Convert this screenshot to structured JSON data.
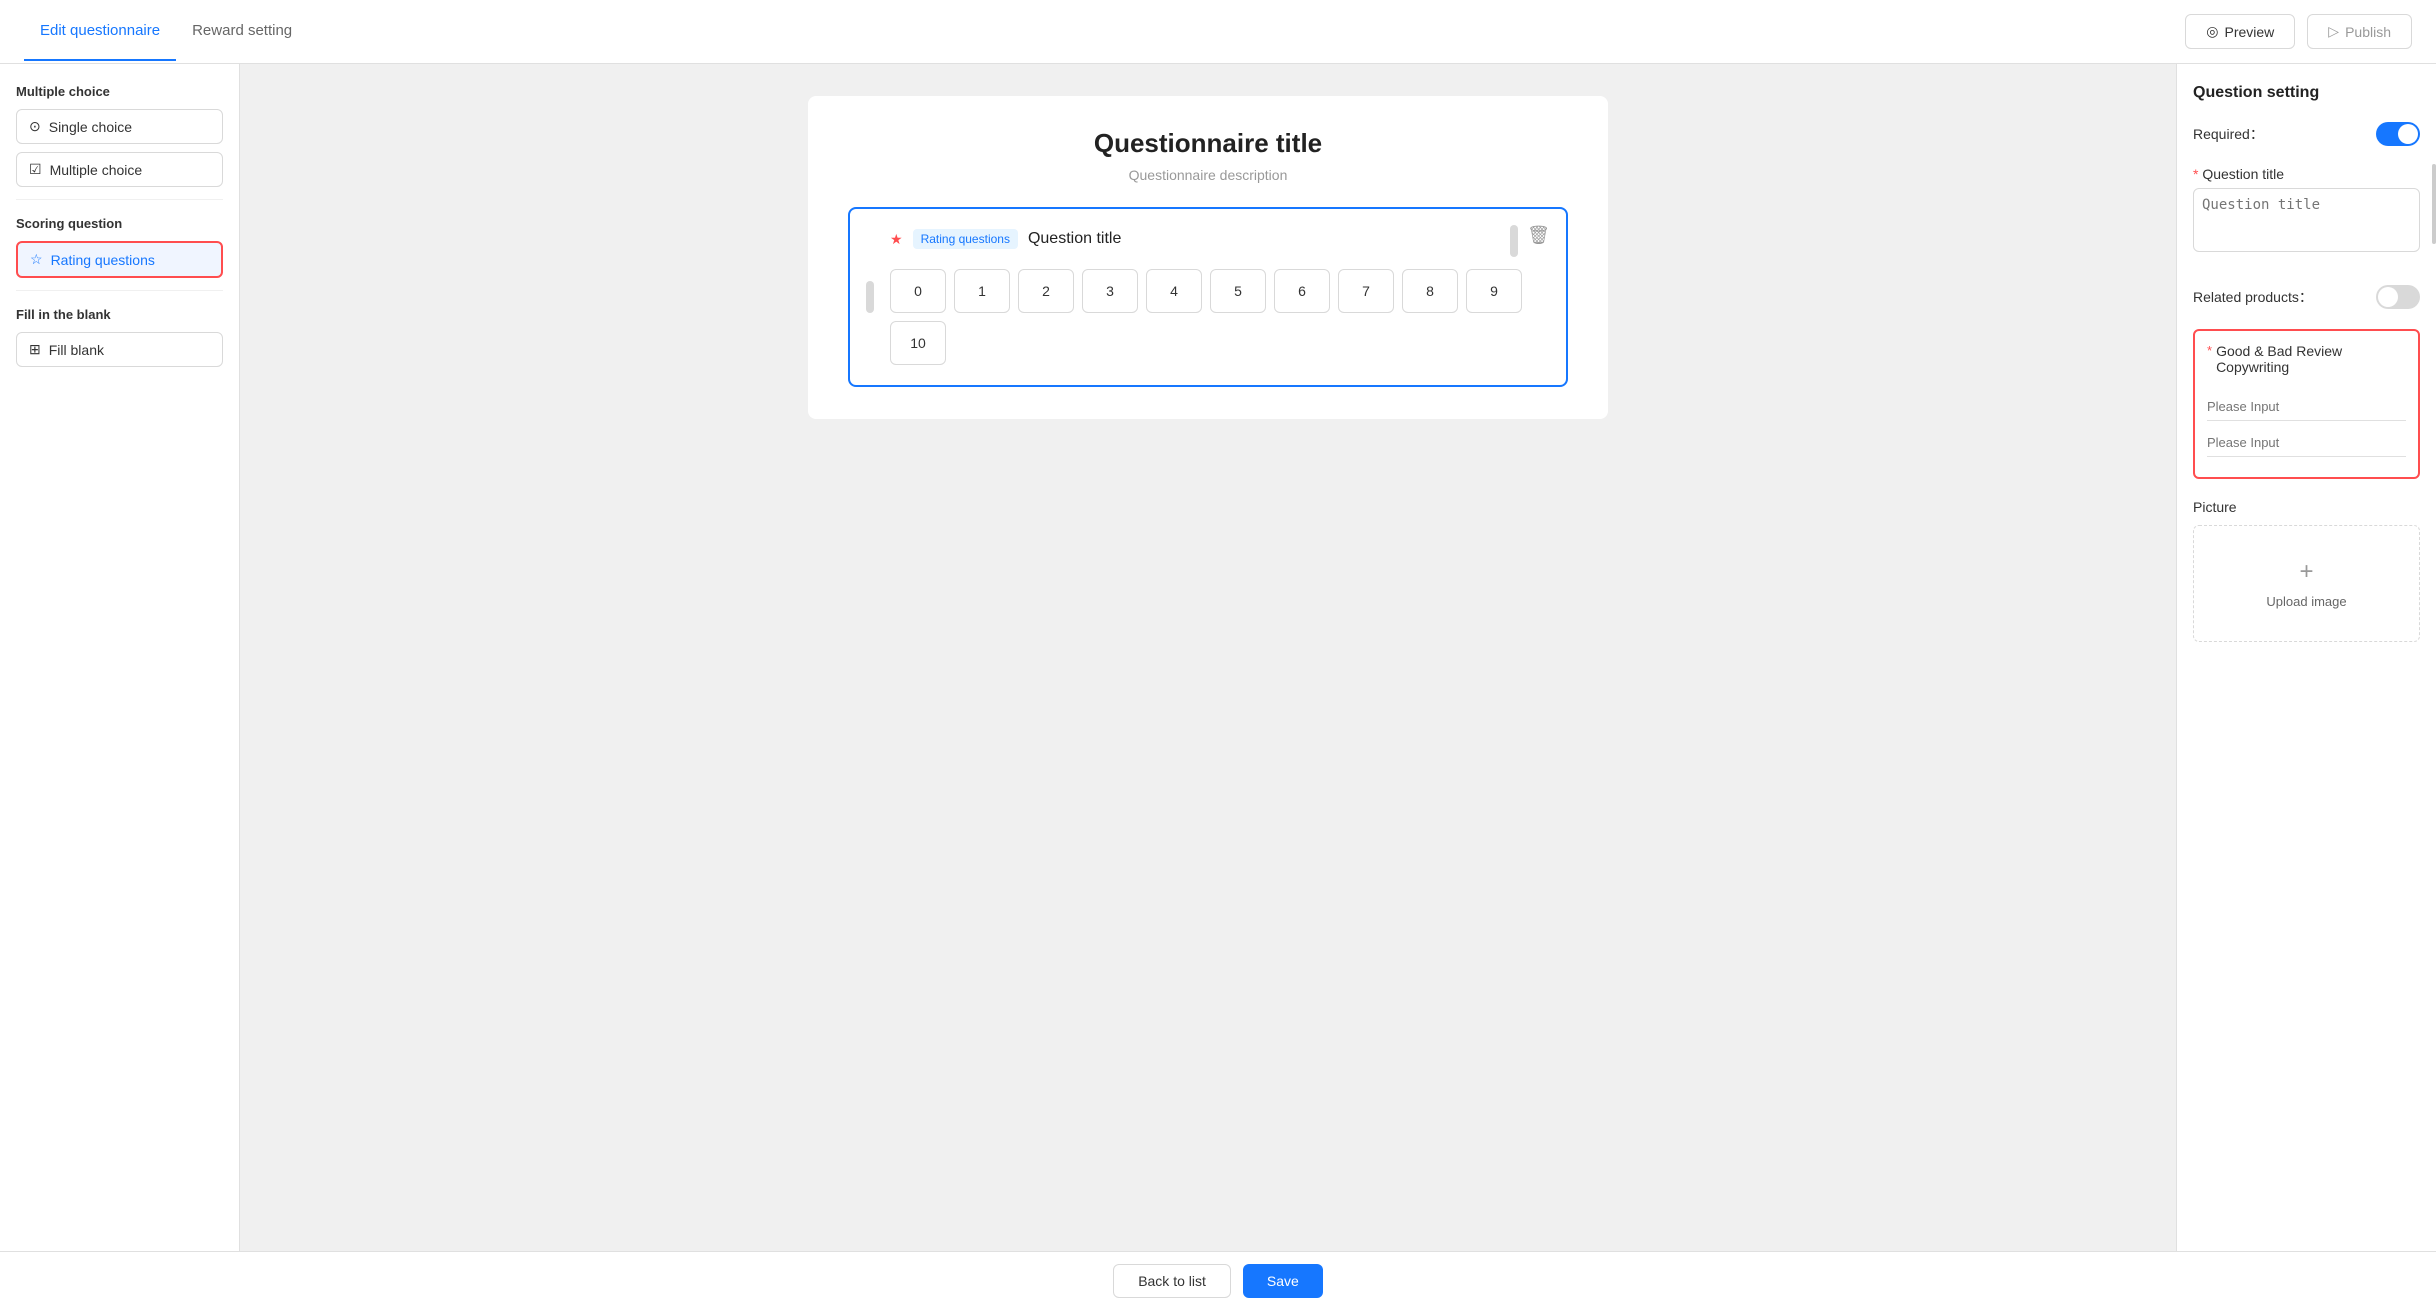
{
  "header": {
    "tab_edit": "Edit questionnaire",
    "tab_reward": "Reward setting",
    "preview_label": "Preview",
    "publish_label": "Publish"
  },
  "sidebar": {
    "section_multiple": "Multiple choice",
    "item_single": "Single choice",
    "item_multiple": "Multiple choice",
    "section_scoring": "Scoring question",
    "item_rating": "Rating questions",
    "section_fill": "Fill in the blank",
    "item_fill": "Fill blank"
  },
  "canvas": {
    "title": "Questionnaire title",
    "description": "Questionnaire description",
    "question": {
      "tag": "Rating questions",
      "title": "Question title",
      "required_star": "★",
      "rating_options": [
        "0",
        "1",
        "2",
        "3",
        "4",
        "5",
        "6",
        "7",
        "8",
        "9",
        "10"
      ]
    }
  },
  "right_panel": {
    "title": "Question setting",
    "required_label": "Required：",
    "question_title_label": "Question title",
    "question_title_placeholder": "Question title",
    "related_products_label": "Related products：",
    "products_box_title": "Good & Bad Review Copywriting",
    "products_input1_placeholder": "Please Input",
    "products_input2_placeholder": "Please Input",
    "picture_label": "Picture",
    "upload_plus": "+",
    "upload_text": "Upload image"
  },
  "footer": {
    "back_label": "Back to list",
    "save_label": "Save"
  },
  "icons": {
    "eye": "◎",
    "play": "▷",
    "circle_check": "⊙",
    "check_box": "☑",
    "star": "☆",
    "image": "⊞",
    "trash": "🗑"
  }
}
